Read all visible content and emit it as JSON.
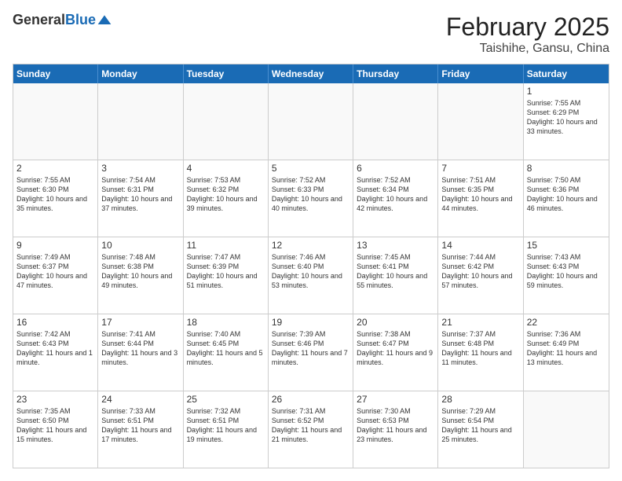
{
  "header": {
    "logo_general": "General",
    "logo_blue": "Blue",
    "title": "February 2025",
    "subtitle": "Taishihe, Gansu, China"
  },
  "days_of_week": [
    "Sunday",
    "Monday",
    "Tuesday",
    "Wednesday",
    "Thursday",
    "Friday",
    "Saturday"
  ],
  "weeks": [
    [
      {
        "day": "",
        "info": ""
      },
      {
        "day": "",
        "info": ""
      },
      {
        "day": "",
        "info": ""
      },
      {
        "day": "",
        "info": ""
      },
      {
        "day": "",
        "info": ""
      },
      {
        "day": "",
        "info": ""
      },
      {
        "day": "1",
        "info": "Sunrise: 7:55 AM\nSunset: 6:29 PM\nDaylight: 10 hours and 33 minutes."
      }
    ],
    [
      {
        "day": "2",
        "info": "Sunrise: 7:55 AM\nSunset: 6:30 PM\nDaylight: 10 hours and 35 minutes."
      },
      {
        "day": "3",
        "info": "Sunrise: 7:54 AM\nSunset: 6:31 PM\nDaylight: 10 hours and 37 minutes."
      },
      {
        "day": "4",
        "info": "Sunrise: 7:53 AM\nSunset: 6:32 PM\nDaylight: 10 hours and 39 minutes."
      },
      {
        "day": "5",
        "info": "Sunrise: 7:52 AM\nSunset: 6:33 PM\nDaylight: 10 hours and 40 minutes."
      },
      {
        "day": "6",
        "info": "Sunrise: 7:52 AM\nSunset: 6:34 PM\nDaylight: 10 hours and 42 minutes."
      },
      {
        "day": "7",
        "info": "Sunrise: 7:51 AM\nSunset: 6:35 PM\nDaylight: 10 hours and 44 minutes."
      },
      {
        "day": "8",
        "info": "Sunrise: 7:50 AM\nSunset: 6:36 PM\nDaylight: 10 hours and 46 minutes."
      }
    ],
    [
      {
        "day": "9",
        "info": "Sunrise: 7:49 AM\nSunset: 6:37 PM\nDaylight: 10 hours and 47 minutes."
      },
      {
        "day": "10",
        "info": "Sunrise: 7:48 AM\nSunset: 6:38 PM\nDaylight: 10 hours and 49 minutes."
      },
      {
        "day": "11",
        "info": "Sunrise: 7:47 AM\nSunset: 6:39 PM\nDaylight: 10 hours and 51 minutes."
      },
      {
        "day": "12",
        "info": "Sunrise: 7:46 AM\nSunset: 6:40 PM\nDaylight: 10 hours and 53 minutes."
      },
      {
        "day": "13",
        "info": "Sunrise: 7:45 AM\nSunset: 6:41 PM\nDaylight: 10 hours and 55 minutes."
      },
      {
        "day": "14",
        "info": "Sunrise: 7:44 AM\nSunset: 6:42 PM\nDaylight: 10 hours and 57 minutes."
      },
      {
        "day": "15",
        "info": "Sunrise: 7:43 AM\nSunset: 6:43 PM\nDaylight: 10 hours and 59 minutes."
      }
    ],
    [
      {
        "day": "16",
        "info": "Sunrise: 7:42 AM\nSunset: 6:43 PM\nDaylight: 11 hours and 1 minute."
      },
      {
        "day": "17",
        "info": "Sunrise: 7:41 AM\nSunset: 6:44 PM\nDaylight: 11 hours and 3 minutes."
      },
      {
        "day": "18",
        "info": "Sunrise: 7:40 AM\nSunset: 6:45 PM\nDaylight: 11 hours and 5 minutes."
      },
      {
        "day": "19",
        "info": "Sunrise: 7:39 AM\nSunset: 6:46 PM\nDaylight: 11 hours and 7 minutes."
      },
      {
        "day": "20",
        "info": "Sunrise: 7:38 AM\nSunset: 6:47 PM\nDaylight: 11 hours and 9 minutes."
      },
      {
        "day": "21",
        "info": "Sunrise: 7:37 AM\nSunset: 6:48 PM\nDaylight: 11 hours and 11 minutes."
      },
      {
        "day": "22",
        "info": "Sunrise: 7:36 AM\nSunset: 6:49 PM\nDaylight: 11 hours and 13 minutes."
      }
    ],
    [
      {
        "day": "23",
        "info": "Sunrise: 7:35 AM\nSunset: 6:50 PM\nDaylight: 11 hours and 15 minutes."
      },
      {
        "day": "24",
        "info": "Sunrise: 7:33 AM\nSunset: 6:51 PM\nDaylight: 11 hours and 17 minutes."
      },
      {
        "day": "25",
        "info": "Sunrise: 7:32 AM\nSunset: 6:51 PM\nDaylight: 11 hours and 19 minutes."
      },
      {
        "day": "26",
        "info": "Sunrise: 7:31 AM\nSunset: 6:52 PM\nDaylight: 11 hours and 21 minutes."
      },
      {
        "day": "27",
        "info": "Sunrise: 7:30 AM\nSunset: 6:53 PM\nDaylight: 11 hours and 23 minutes."
      },
      {
        "day": "28",
        "info": "Sunrise: 7:29 AM\nSunset: 6:54 PM\nDaylight: 11 hours and 25 minutes."
      },
      {
        "day": "",
        "info": ""
      }
    ]
  ]
}
